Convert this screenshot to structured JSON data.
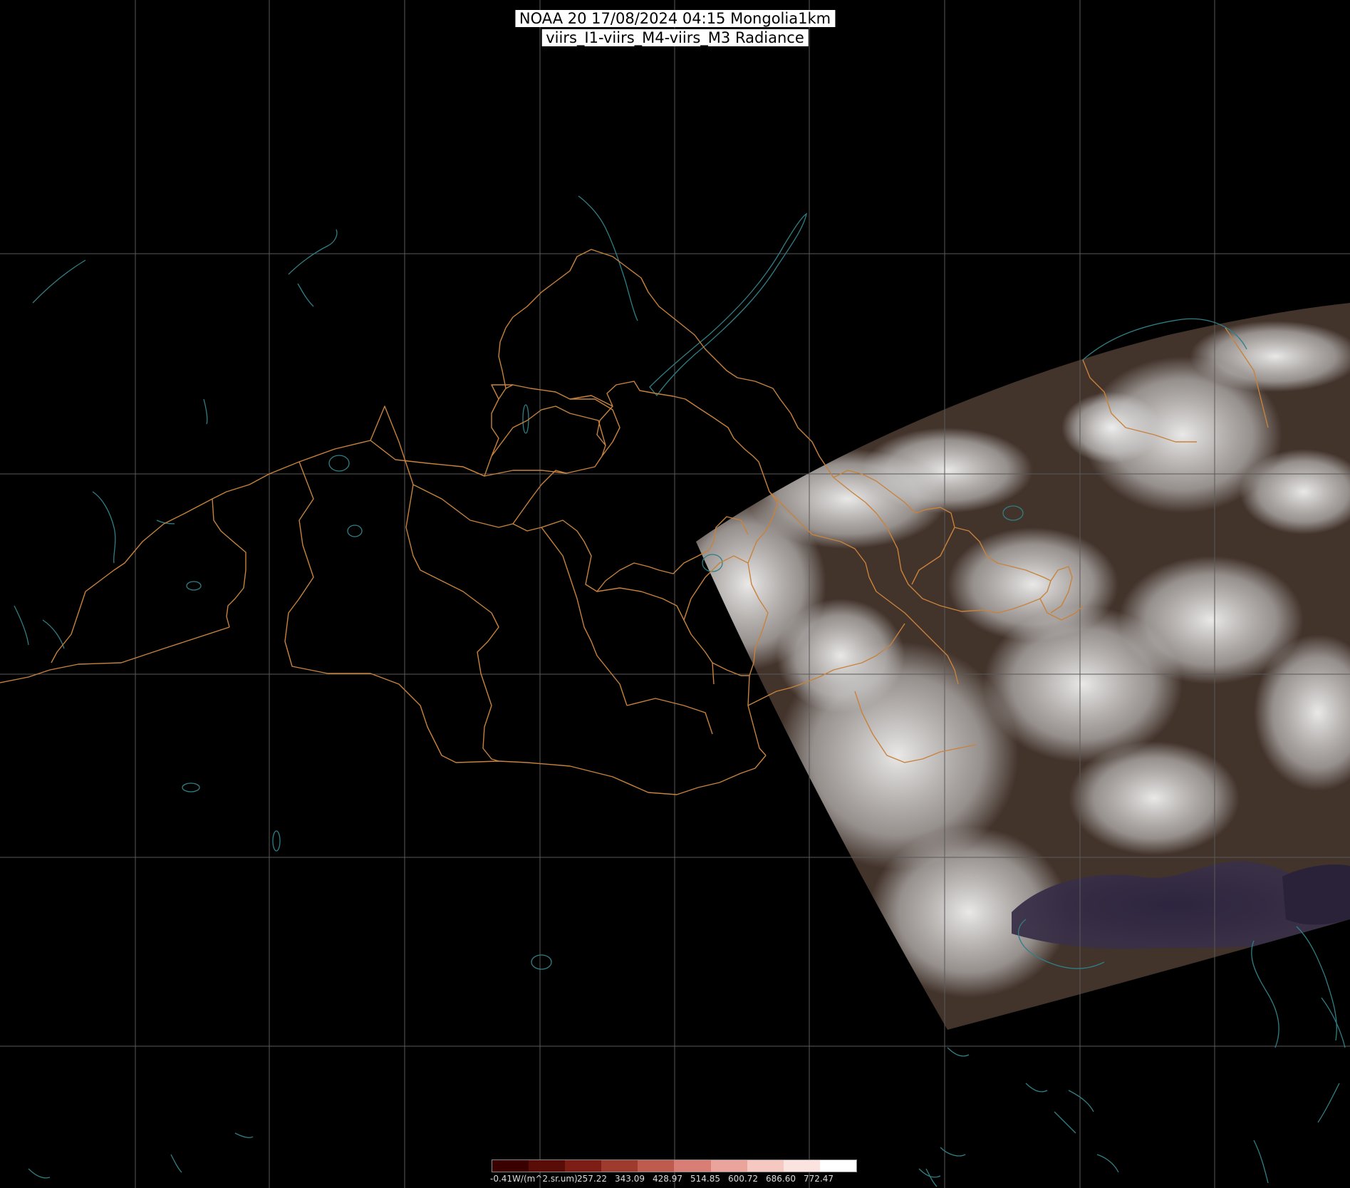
{
  "title": {
    "line1": "NOAA 20 17/08/2024 04:15 Mongolia1km",
    "line2": "viirs_I1-viirs_M4-viirs_M3 Radiance"
  },
  "colorbar": {
    "ticks": [
      "-0.41W/(m^2.sr.um)",
      "257.22",
      "343.09",
      "428.97",
      "514.85",
      "600.72",
      "686.60",
      "772.47"
    ],
    "colors": [
      "#3a0000",
      "#5a0c08",
      "#7d1e16",
      "#9e3a2e",
      "#bf5a4e",
      "#d97e74",
      "#eba49c",
      "#f5c8c2",
      "#fbe4e0",
      "#ffffff"
    ]
  },
  "map_colors": {
    "border": "#c8823c",
    "coast": "#2f7f86",
    "grid": "#5a5a5a",
    "land": "#3e2f28",
    "cloud": "#d9d9d9"
  }
}
